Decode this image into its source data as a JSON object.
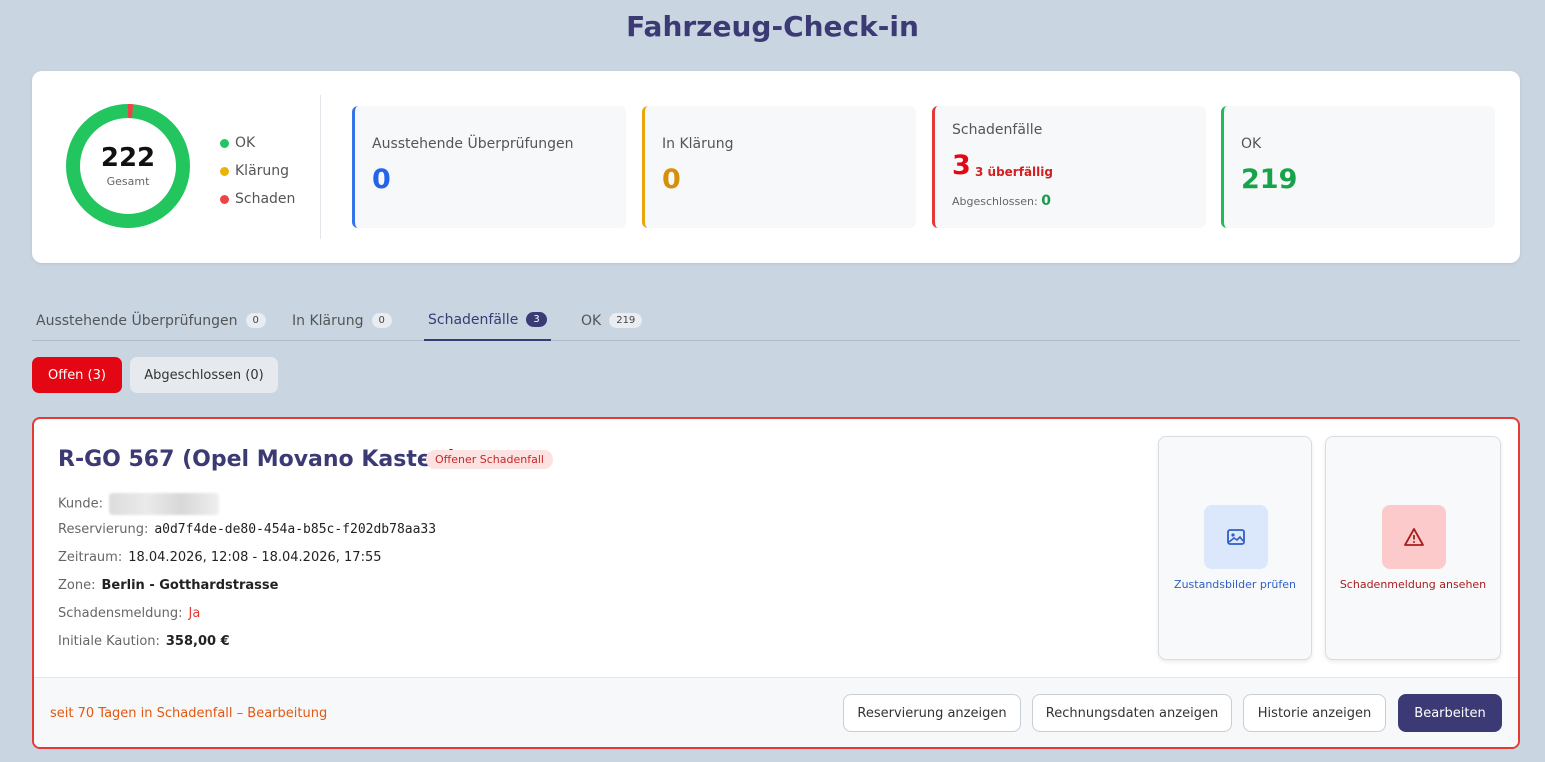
{
  "page": {
    "title": "Fahrzeug-Check-in"
  },
  "summary": {
    "total": "222",
    "total_label": "Gesamt",
    "donut": {
      "ok": 219,
      "klaerung": 0,
      "schaden": 3
    },
    "legend": [
      {
        "label": "OK",
        "color": "#22c55e"
      },
      {
        "label": "Klärung",
        "color": "#eab308"
      },
      {
        "label": "Schaden",
        "color": "#ef4444"
      }
    ],
    "stats": {
      "pending": {
        "title": "Ausstehende Überprüfungen",
        "value": "0",
        "color": "#2563eb"
      },
      "clarification": {
        "title": "In Klärung",
        "value": "0",
        "color": "#d4900b"
      },
      "damage": {
        "title": "Schadenfälle",
        "value": "3",
        "color": "#e30613",
        "overdue": "3 überfällig",
        "closed_label": "Abgeschlossen:",
        "closed_value": "0"
      },
      "ok": {
        "title": "OK",
        "value": "219",
        "color": "#16a34a"
      }
    }
  },
  "tabs": [
    {
      "label": "Ausstehende Überprüfungen",
      "count": "0"
    },
    {
      "label": "In Klärung",
      "count": "0"
    },
    {
      "label": "Schadenfälle",
      "count": "3"
    },
    {
      "label": "OK",
      "count": "219"
    }
  ],
  "filters": {
    "open": "Offen (3)",
    "closed": "Abgeschlossen (0)"
  },
  "case": {
    "title": "R-GO 567 (Opel Movano Kasten)",
    "badge": "Offener Schadenfall",
    "fields": {
      "customer_label": "Kunde:",
      "reservation_label": "Reservierung:",
      "reservation_value": "a0d7f4de-de80-454a-b85c-f202db78aa33",
      "period_label": "Zeitraum:",
      "period_value": "18.04.2026, 12:08 - 18.04.2026, 17:55",
      "zone_label": "Zone:",
      "zone_value": "Berlin - Gotthardstrasse",
      "report_label": "Schadensmeldung:",
      "report_value": "Ja",
      "deposit_label": "Initiale Kaution:",
      "deposit_value": "358,00 €"
    },
    "actions": {
      "images": "Zustandsbilder prüfen",
      "report": "Schadenmeldung ansehen"
    },
    "footer_note": "seit 70 Tagen in Schadenfall – Bearbeitung",
    "buttons": {
      "reservation": "Reservierung anzeigen",
      "invoice": "Rechnungsdaten anzeigen",
      "history": "Historie anzeigen",
      "edit": "Bearbeiten"
    }
  }
}
